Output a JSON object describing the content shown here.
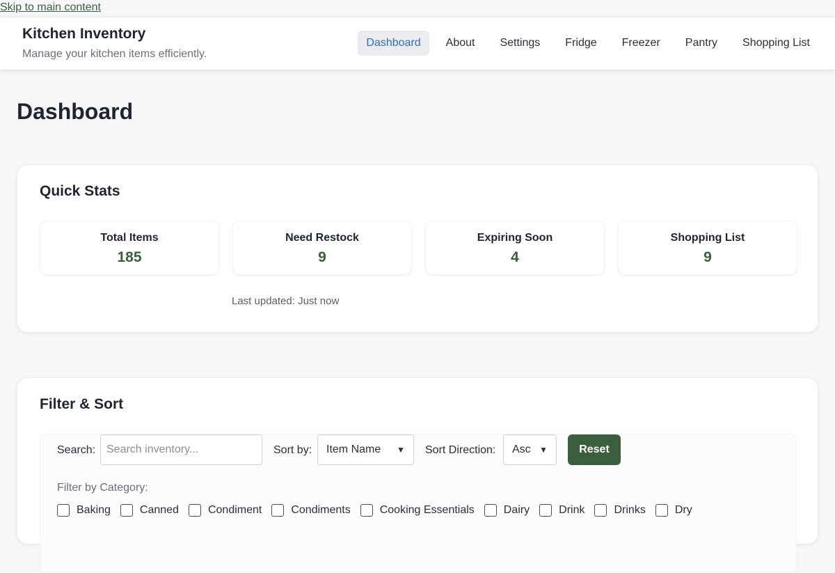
{
  "skip_link": "Skip to main content",
  "header": {
    "title": "Kitchen Inventory",
    "subtitle": "Manage your kitchen items efficiently."
  },
  "nav": {
    "items": [
      {
        "label": "Dashboard",
        "active": true
      },
      {
        "label": "About"
      },
      {
        "label": "Settings"
      },
      {
        "label": "Fridge"
      },
      {
        "label": "Freezer"
      },
      {
        "label": "Pantry"
      },
      {
        "label": "Shopping List"
      }
    ]
  },
  "page": {
    "title": "Dashboard"
  },
  "quick_stats": {
    "title": "Quick Stats",
    "stats": [
      {
        "label": "Total Items",
        "value": "185"
      },
      {
        "label": "Need Restock",
        "value": "9"
      },
      {
        "label": "Expiring Soon",
        "value": "4"
      },
      {
        "label": "Shopping List",
        "value": "9"
      }
    ],
    "last_updated": "Last updated: Just now"
  },
  "filter_sort": {
    "title": "Filter & Sort",
    "search_label": "Search:",
    "search_placeholder": "Search inventory...",
    "search_value": "",
    "sort_by_label": "Sort by:",
    "sort_by_value": "Item Name",
    "sort_dir_label": "Sort Direction:",
    "sort_dir_value": "Asc",
    "reset_label": "Reset",
    "category_label": "Filter by Category:",
    "categories": [
      "Baking",
      "Canned",
      "Condiment",
      "Condiments",
      "Cooking Essentials",
      "Dairy",
      "Drink",
      "Drinks",
      "Dry"
    ]
  },
  "colors": {
    "accent_green": "#3b5e3c",
    "nav_active_text": "#2f72b8"
  }
}
